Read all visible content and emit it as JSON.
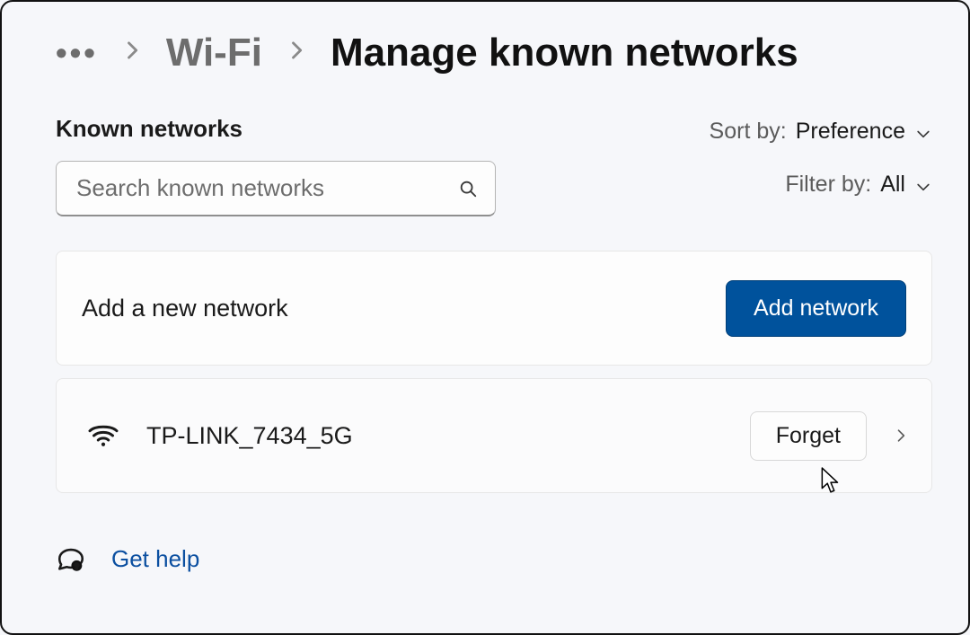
{
  "breadcrumb": {
    "ellipsis": "•••",
    "parent": "Wi-Fi",
    "current": "Manage known networks"
  },
  "section": {
    "title": "Known networks",
    "search_placeholder": "Search known networks"
  },
  "sort": {
    "label": "Sort by:",
    "value": "Preference"
  },
  "filter": {
    "label": "Filter by:",
    "value": "All"
  },
  "add_card": {
    "label": "Add a new network",
    "button": "Add network"
  },
  "networks": [
    {
      "name": "TP-LINK_7434_5G",
      "forget_label": "Forget"
    }
  ],
  "help": {
    "label": "Get help"
  }
}
